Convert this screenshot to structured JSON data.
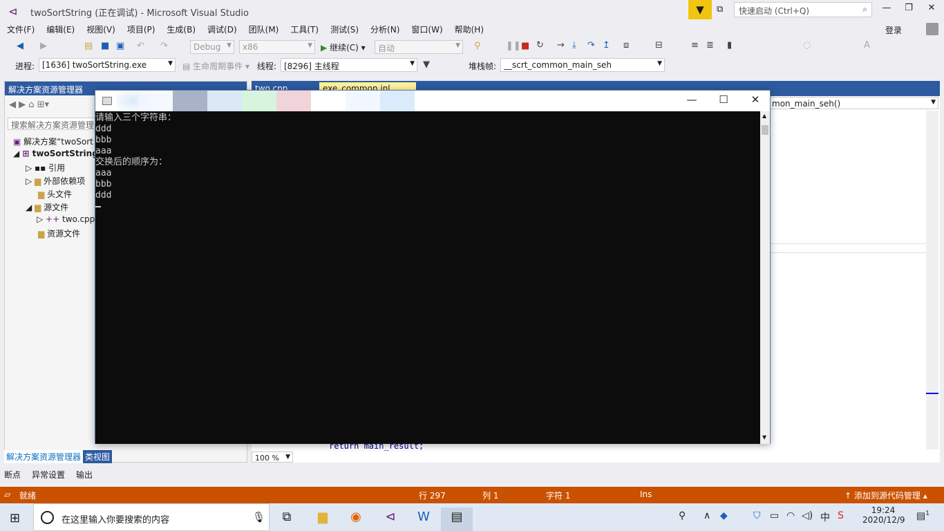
{
  "window": {
    "title": "twoSortString (正在调试) - Microsoft Visual Studio",
    "quick_launch_placeholder": "快速启动 (Ctrl+Q)",
    "login": "登录"
  },
  "menu": [
    "文件(F)",
    "编辑(E)",
    "视图(V)",
    "项目(P)",
    "生成(B)",
    "调试(D)",
    "团队(M)",
    "工具(T)",
    "测试(S)",
    "分析(N)",
    "窗口(W)",
    "帮助(H)"
  ],
  "toolbar": {
    "config": "Debug",
    "platform": "x86",
    "continue_label": "继续(C)",
    "auto": "自动"
  },
  "debug_location": {
    "process_label": "进程:",
    "process_value": "[1636] twoSortString.exe",
    "lifecycle_label": "生命周期事件",
    "thread_label": "线程:",
    "thread_value": "[8296] 主线程",
    "stack_label": "堆栈帧:",
    "stack_value": "__scrt_common_main_seh"
  },
  "solution_explorer": {
    "title": "解决方案资源管理器",
    "search_placeholder": "搜索解决方案资源管理器",
    "items": [
      {
        "label": "解决方案“twoSort"
      },
      {
        "label": "twoSortString"
      },
      {
        "label": "引用"
      },
      {
        "label": "外部依赖项"
      },
      {
        "label": "头文件"
      },
      {
        "label": "源文件"
      },
      {
        "label": "two.cpp"
      },
      {
        "label": "资源文件"
      }
    ],
    "bottom_tabs": [
      "解决方案资源管理器",
      "类视图"
    ]
  },
  "editor": {
    "tabs": [
      "two.cpp",
      "exe_common.inl"
    ],
    "nav_right": "mon_main_seh()",
    "code_line": "return main_result;",
    "zoom": "100 %"
  },
  "output_tabs": [
    "断点",
    "异常设置",
    "输出"
  ],
  "console": {
    "lines": [
      "请输入三个字符串：",
      "ddd",
      "bbb",
      "aaa",
      "交换后的顺序为：",
      "aaa",
      "bbb",
      "ddd"
    ]
  },
  "statusbar": {
    "state": "就绪",
    "row": "行 297",
    "col": "列 1",
    "char": "字符 1",
    "ins": "Ins",
    "source_control": "添加到源代码管理"
  },
  "taskbar": {
    "search_placeholder": "在这里输入你要搜索的内容",
    "time": "19:24",
    "date": "2020/12/9",
    "ime": "中",
    "notification_count": "1"
  }
}
